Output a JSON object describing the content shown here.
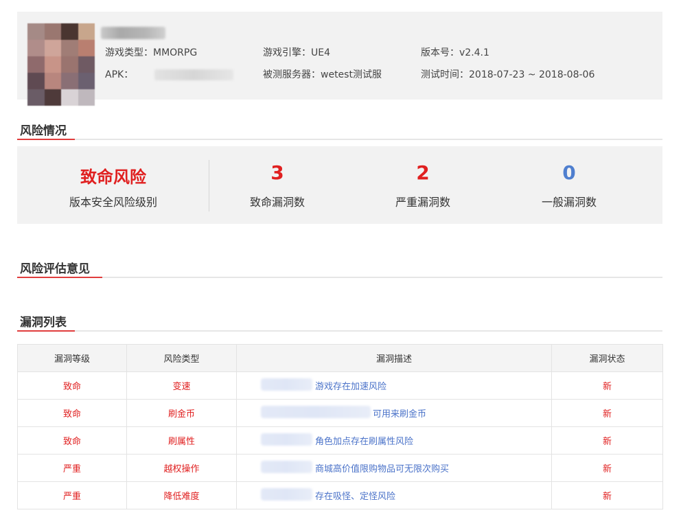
{
  "header": {
    "game_type_label": "游戏类型：",
    "game_type": "MMORPG",
    "engine_label": "游戏引擎：",
    "engine": "UE4",
    "version_label": "版本号：",
    "version": "v2.4.1",
    "apk_label": "APK：",
    "server_label": "被测服务器：",
    "server": "wetest测试服",
    "test_time_label": "测试时间：",
    "test_time": "2018-07-23 ~ 2018-08-06"
  },
  "sections": {
    "risk": "风险情况",
    "assessment": "风险评估意见",
    "vuln_list": "漏洞列表"
  },
  "risk_summary": {
    "level": "致命风险",
    "level_label": "版本安全风险级别",
    "fatal_count": "3",
    "fatal_label": "致命漏洞数",
    "severe_count": "2",
    "severe_label": "严重漏洞数",
    "normal_count": "0",
    "normal_label": "一般漏洞数"
  },
  "table": {
    "headers": [
      "漏洞等级",
      "风险类型",
      "漏洞描述",
      "漏洞状态"
    ],
    "rows": [
      {
        "level": "致命",
        "type": "变速",
        "desc": "游戏存在加速风险",
        "status": "新"
      },
      {
        "level": "致命",
        "type": "刷金币",
        "desc": "可用来刷金币",
        "status": "新"
      },
      {
        "level": "致命",
        "type": "刷属性",
        "desc": "角色加点存在刷属性风险",
        "status": "新"
      },
      {
        "level": "严重",
        "type": "越权操作",
        "desc": "商城高价值限购物品可无限次购买",
        "status": "新"
      },
      {
        "level": "严重",
        "type": "降低难度",
        "desc": "存在吸怪、定怪风险",
        "status": "新"
      }
    ]
  },
  "colors": {
    "fatal": "#e02020",
    "normal": "#4f7fcf",
    "accent_line": "#e03c3c",
    "link": "#4b73c9"
  }
}
